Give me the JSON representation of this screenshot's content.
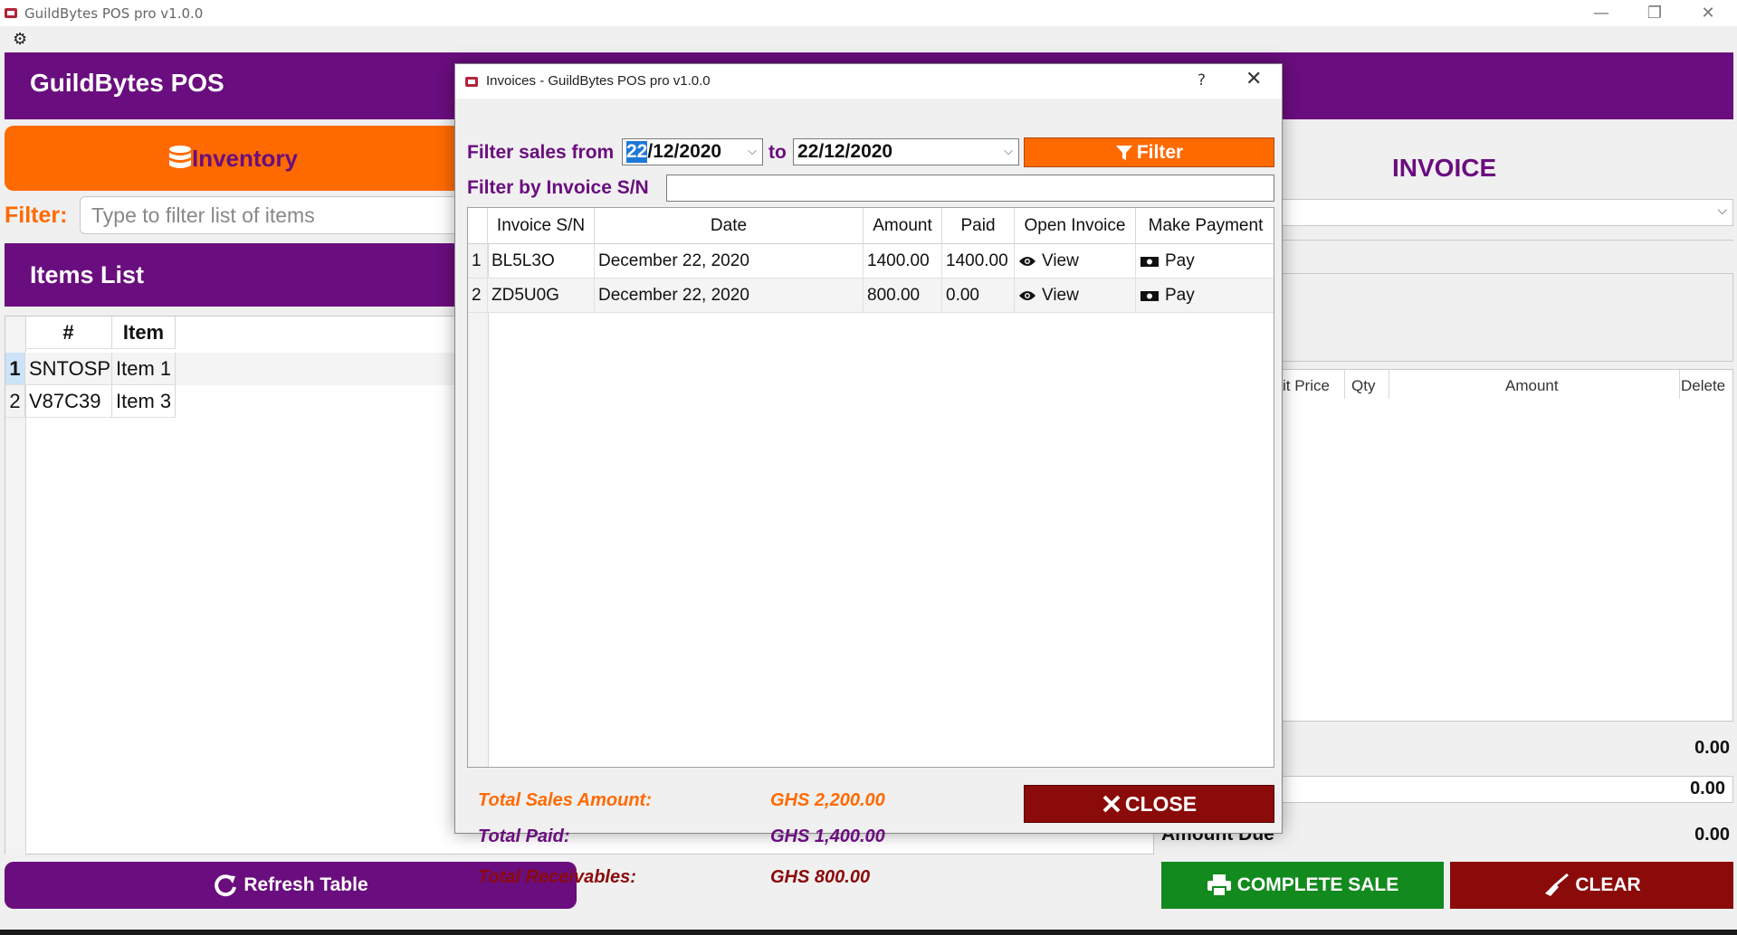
{
  "window": {
    "title": "GuildBytes POS pro v1.0.0",
    "controls": [
      "—",
      "❐",
      "✕"
    ]
  },
  "app": {
    "brand": "GuildBytes POS",
    "inventory_label": "Inventory",
    "filter_label": "Filter:",
    "filter_placeholder": "Type to filter list of items",
    "items_list_title": "Items List",
    "refresh_label": "Refresh Table"
  },
  "items_table": {
    "columns": [
      "#",
      "Item"
    ],
    "rows": [
      {
        "num": "1",
        "code": "SNTOSP",
        "item": "Item 1"
      },
      {
        "num": "2",
        "code": "V87C39",
        "item": "Item 3"
      }
    ]
  },
  "invoice_panel": {
    "heading": "INVOICE",
    "cart_columns": [
      "it Price",
      "Qty",
      "Amount",
      "Delete"
    ],
    "subtotal": "0.00",
    "discount": "0.00",
    "amount_due_label": "Amount Due",
    "amount_due": "0.00",
    "complete_label": "COMPLETE SALE",
    "clear_label": "CLEAR"
  },
  "dialog": {
    "title": "Invoices - GuildBytes POS pro v1.0.0",
    "help": "?",
    "close_x": "✕",
    "filter_from_label": "Filter sales from",
    "date_from_day": "22",
    "date_from_rest": "/12/2020",
    "to_label": "to",
    "date_to": "22/12/2020",
    "filter_button": "Filter",
    "filter_sn_label": "Filter by Invoice S/N",
    "filter_sn_value": "",
    "table": {
      "columns": [
        "Invoice S/N",
        "Date",
        "Amount",
        "Paid",
        "Open Invoice",
        "Make Payment"
      ],
      "rows": [
        {
          "idx": "1",
          "sn": "BL5L3O",
          "date": "December 22, 2020",
          "amount": "1400.00",
          "paid": "1400.00",
          "open": "View",
          "pay": "Pay"
        },
        {
          "idx": "2",
          "sn": "ZD5U0G",
          "date": "December 22, 2020",
          "amount": "800.00",
          "paid": "0.00",
          "open": "View",
          "pay": "Pay"
        }
      ]
    },
    "totals": {
      "sales_label": "Total Sales Amount:",
      "sales_value": "GHS 2,200.00",
      "paid_label": "Total Paid:",
      "paid_value": "GHS 1,400.00",
      "receivables_label": "Total Receivables:",
      "receivables_value": "GHS 800.00"
    },
    "close_button": "CLOSE"
  },
  "colors": {
    "purple": "#6a0d7e",
    "orange": "#ff6a00",
    "green": "#128a1e",
    "dark_red": "#8b0a0a"
  }
}
